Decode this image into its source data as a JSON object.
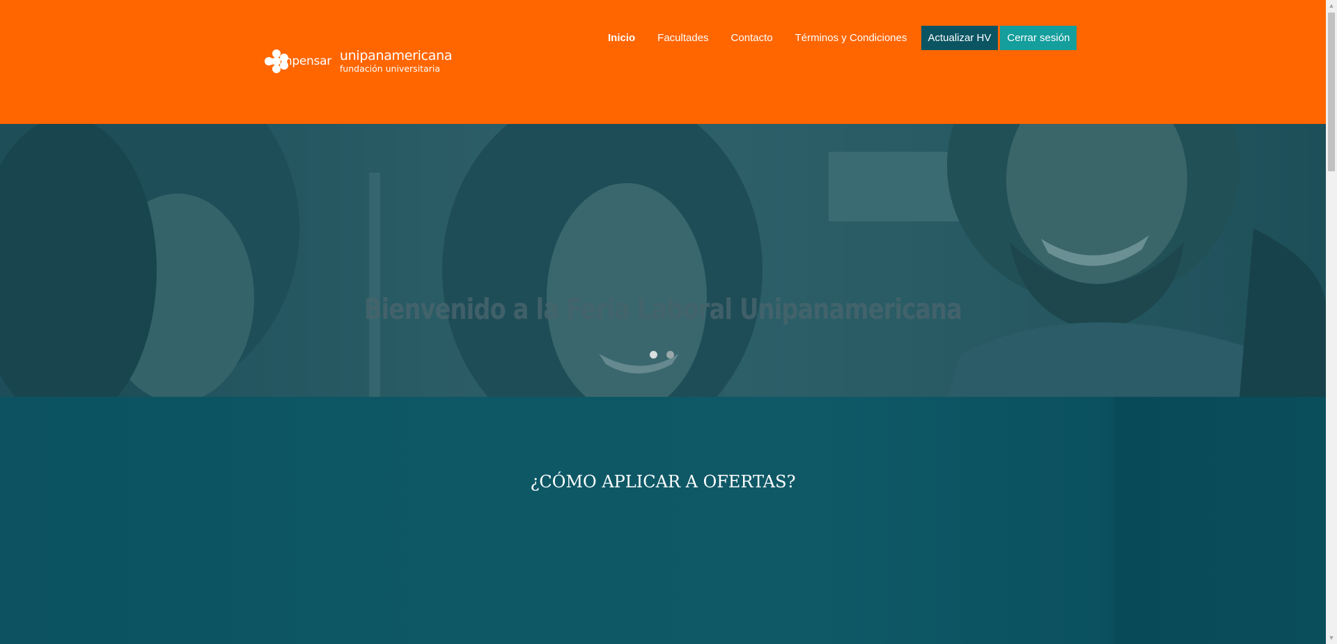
{
  "header": {
    "logo": {
      "brand": "compensar",
      "name": "unipanamericana",
      "subtitle": "fundación universitaria"
    },
    "nav": [
      {
        "label": "Inicio",
        "active": true
      },
      {
        "label": "Facultades",
        "active": false
      },
      {
        "label": "Contacto",
        "active": false
      },
      {
        "label": "Términos y Condiciones",
        "active": false
      }
    ],
    "update_cv_button": "Actualizar HV",
    "logout_button": "Cerrar sesión"
  },
  "hero": {
    "title": "Bienvenido a la Feria Laboral Unipanamericana",
    "slide_count": 2,
    "active_slide": 1
  },
  "section": {
    "title": "¿CÓMO APLICAR A OFERTAS?"
  },
  "colors": {
    "header_bg": "#ff6600",
    "section_bg": "#0e5866",
    "update_cv_bg": "#0b5563",
    "logout_bg": "#149e9c"
  }
}
